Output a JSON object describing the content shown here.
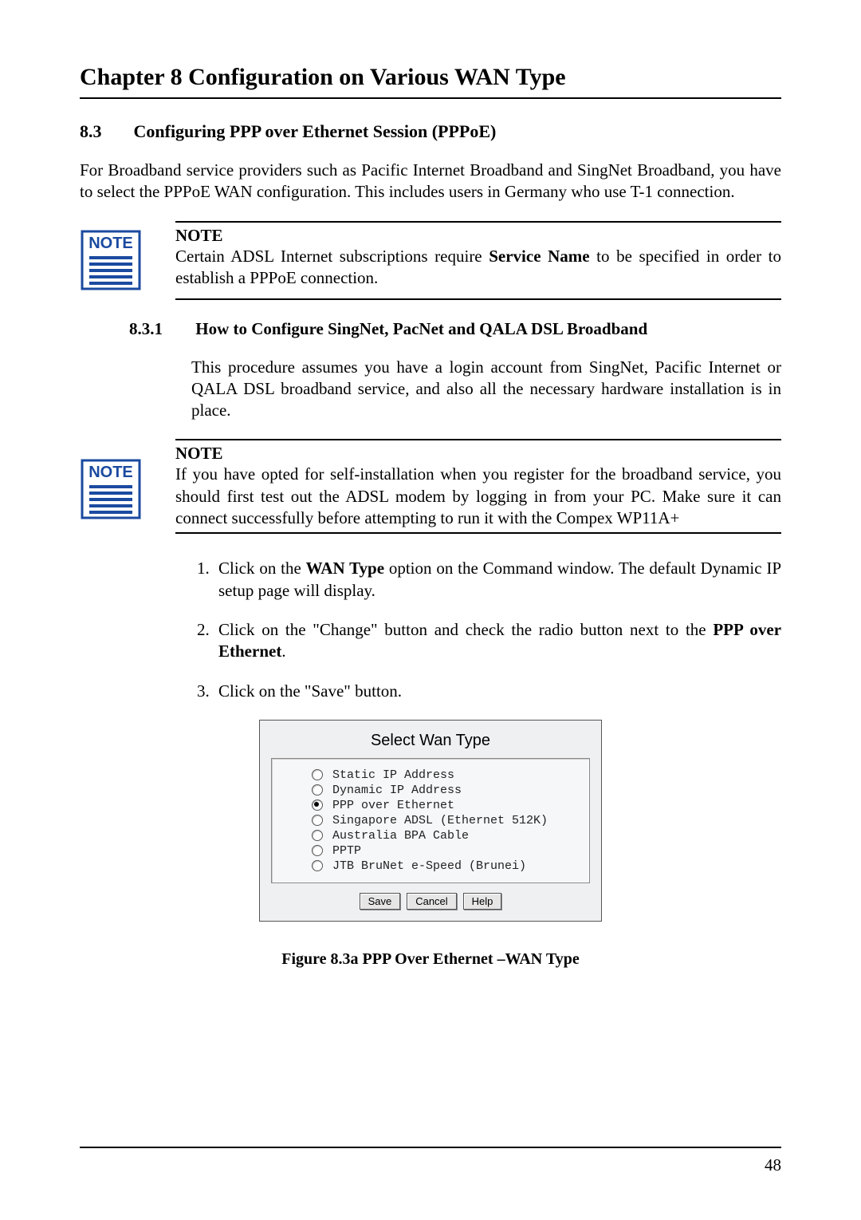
{
  "chapter": {
    "title": "Chapter 8     Configuration on Various WAN Type"
  },
  "section": {
    "number": "8.3",
    "heading": "Configuring PPP over Ethernet Session (PPPoE)",
    "intro": "For Broadband service providers such as Pacific Internet Broadband and SingNet Broadband, you have to select the PPPoE WAN configuration. This includes users in Germany who use T-1 connection."
  },
  "note1": {
    "label": "NOTE",
    "title": "NOTE",
    "body_pre": "Certain ADSL Internet subscriptions require ",
    "body_bold": "Service Name",
    "body_post": " to be specified in order to establish a PPPoE connection."
  },
  "subsection": {
    "number": "8.3.1",
    "heading": "How to Configure SingNet, PacNet and QALA DSL Broadband",
    "intro": "This procedure assumes you have a login account from SingNet, Pacific Internet or QALA DSL broadband service, and also all the necessary hardware installation is in place."
  },
  "note2": {
    "label": "NOTE",
    "title": "NOTE",
    "body": "If you have opted for self-installation when you register for the broadband service, you should first test out the ADSL modem by logging in from your PC. Make sure it can connect successfully before attempting to run it with the Compex WP11A+"
  },
  "steps": {
    "s1_pre": "Click on the ",
    "s1_bold": "WAN Type",
    "s1_post": " option on the Command window. The default Dynamic IP setup page will display.",
    "s2_pre": "Click on the \"Change\" button and check the radio button next to the ",
    "s2_bold": "PPP over Ethernet",
    "s2_post": ".",
    "s3": "Click on the \"Save\" button."
  },
  "dialog": {
    "title": "Select Wan Type",
    "options": [
      {
        "label": "Static IP Address",
        "selected": false
      },
      {
        "label": "Dynamic IP Address",
        "selected": false
      },
      {
        "label": "PPP over Ethernet",
        "selected": true
      },
      {
        "label": "Singapore ADSL (Ethernet 512K)",
        "selected": false
      },
      {
        "label": "Australia BPA Cable",
        "selected": false
      },
      {
        "label": "PPTP",
        "selected": false
      },
      {
        "label": "JTB BruNet e-Speed (Brunei)",
        "selected": false
      }
    ],
    "buttons": {
      "save": "Save",
      "cancel": "Cancel",
      "help": "Help"
    }
  },
  "figure": {
    "caption": "Figure 8.3a      PPP Over Ethernet –WAN Type"
  },
  "page_number": "48"
}
